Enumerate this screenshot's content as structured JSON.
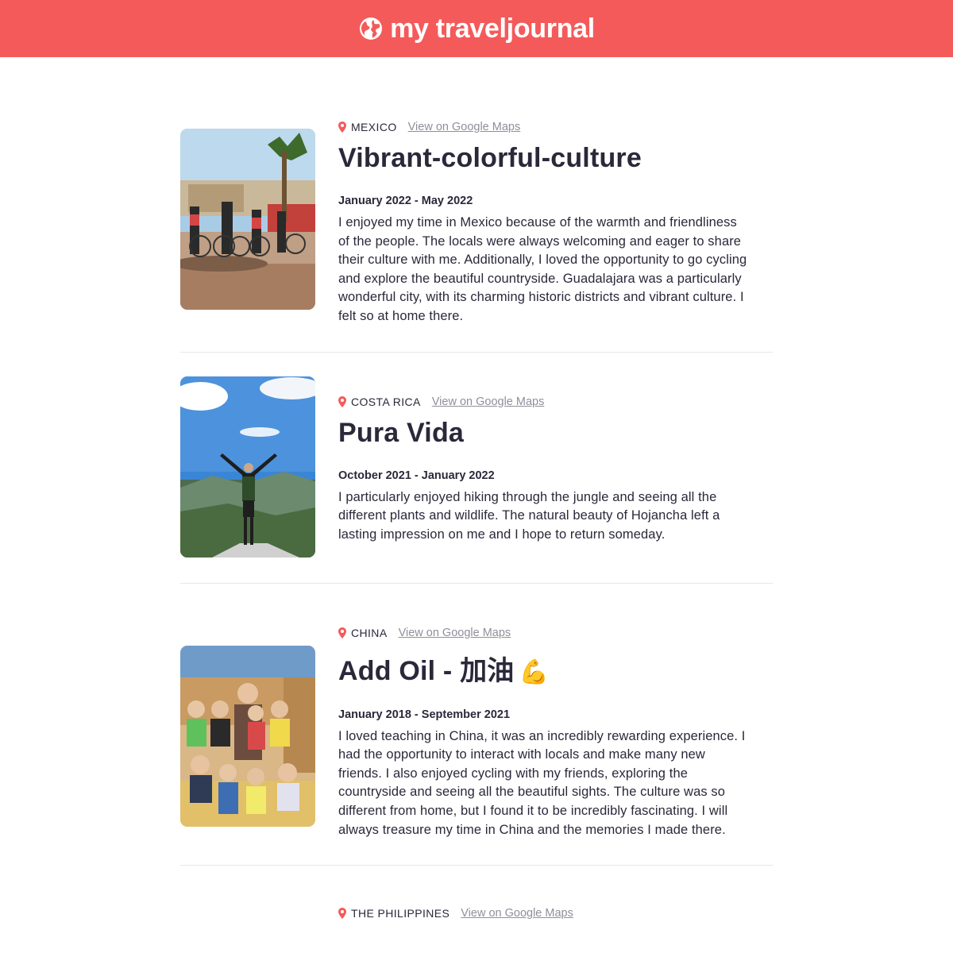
{
  "app": {
    "title": "my traveljournal",
    "icon": "globe-icon",
    "brand_color": "#f55a5a"
  },
  "entries": [
    {
      "country": "MEXICO",
      "maps_label": "View on Google Maps",
      "title": "Vibrant-colorful-culture",
      "dates": "January 2022 - May 2022",
      "description": "I enjoyed my time in Mexico because of the warmth and friendliness of the people. The locals were always welcoming and eager to share their culture with me. Additionally, I loved the opportunity to go cycling and explore the beautiful countryside. Guadalajara was a particularly wonderful city, with its charming historic districts and vibrant culture. I felt so at home there."
    },
    {
      "country": "COSTA RICA",
      "maps_label": "View on Google Maps",
      "title": "Pura Vida",
      "dates": "October 2021 - January 2022",
      "description": "I particularly enjoyed hiking through the jungle and seeing all the different plants and wildlife. The natural beauty of Hojancha left a lasting impression on me and I hope to return someday."
    },
    {
      "country": "CHINA",
      "maps_label": "View on Google Maps",
      "title": "Add Oil - 加油",
      "title_emoji": "💪",
      "dates": "January 2018 - September 2021",
      "description": "I loved teaching in China, it was an incredibly rewarding experience. I had the opportunity to interact with locals and make many new friends. I also enjoyed cycling with my friends, exploring the countryside and seeing all the beautiful sights. The culture was so different from home, but I found it to be incredibly fascinating. I will always treasure my time in China and the memories I made there."
    },
    {
      "country": "THE PHILIPPINES",
      "maps_label": "View on Google Maps"
    }
  ]
}
